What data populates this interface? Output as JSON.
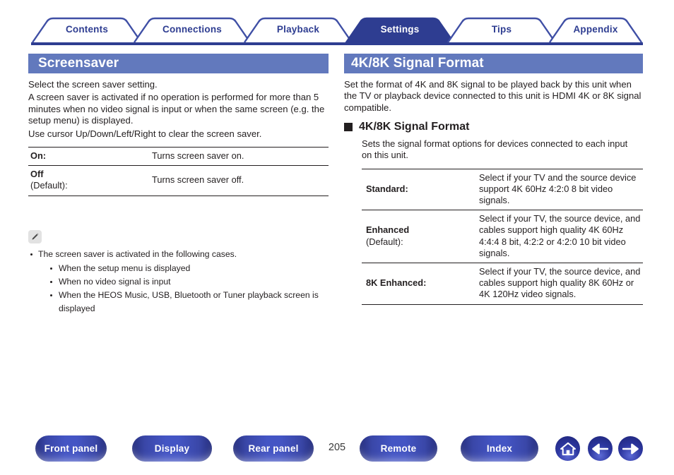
{
  "tabs": [
    {
      "label": "Contents",
      "active": false
    },
    {
      "label": "Connections",
      "active": false
    },
    {
      "label": "Playback",
      "active": false
    },
    {
      "label": "Settings",
      "active": true
    },
    {
      "label": "Tips",
      "active": false
    },
    {
      "label": "Appendix",
      "active": false
    }
  ],
  "left": {
    "title": "Screensaver",
    "paragraphs": [
      "Select the screen saver setting.",
      "A screen saver is activated if no operation is performed for more than 5 minutes when no video signal is input or when the same screen (e.g. the setup menu) is displayed.",
      "Use cursor Up/Down/Left/Right to clear the screen saver."
    ],
    "table": [
      {
        "label": "On:",
        "sublabel": "",
        "desc": "Turns screen saver on."
      },
      {
        "label": "Off",
        "sublabel": "(Default):",
        "desc": "Turns screen saver off."
      }
    ],
    "note": {
      "icon": "pencil-icon",
      "items": [
        "The screen saver is activated in the following cases."
      ],
      "subitems": [
        "When the setup menu is displayed",
        "When no video signal is input",
        "When the HEOS Music, USB, Bluetooth or Tuner playback screen is displayed"
      ]
    }
  },
  "right": {
    "title": "4K/8K Signal Format",
    "intro": "Set the format of 4K and 8K signal to be played back by this unit when the TV or playback device connected to this unit is HDMI 4K or 8K signal compatible.",
    "subheading": "4K/8K Signal Format",
    "subintro": "Sets the signal format options for devices connected to each input on this unit.",
    "table": [
      {
        "label": "Standard:",
        "sublabel": "",
        "desc": "Select if your TV and the source device support 4K 60Hz 4:2:0 8 bit video signals."
      },
      {
        "label": "Enhanced",
        "sublabel": "(Default):",
        "desc": "Select if your TV, the source device, and cables support high quality 4K 60Hz 4:4:4 8 bit, 4:2:2 or 4:2:0 10 bit video signals."
      },
      {
        "label": "8K Enhanced:",
        "sublabel": "",
        "desc": "Select if your TV, the source device, and cables support high quality 8K 60Hz or 4K 120Hz video signals."
      }
    ]
  },
  "bottom": {
    "buttons": [
      {
        "label": "Front panel"
      },
      {
        "label": "Display"
      },
      {
        "label": "Rear panel"
      },
      {
        "label": "Remote"
      },
      {
        "label": "Index"
      }
    ],
    "page_number": "205",
    "icons": [
      {
        "name": "home-icon"
      },
      {
        "name": "arrow-left-icon"
      },
      {
        "name": "arrow-right-icon"
      }
    ]
  },
  "colors": {
    "navy": "#2e3d91",
    "header_blue": "#6279bd",
    "button_blue": "#4455c4",
    "text": "#231f20"
  }
}
